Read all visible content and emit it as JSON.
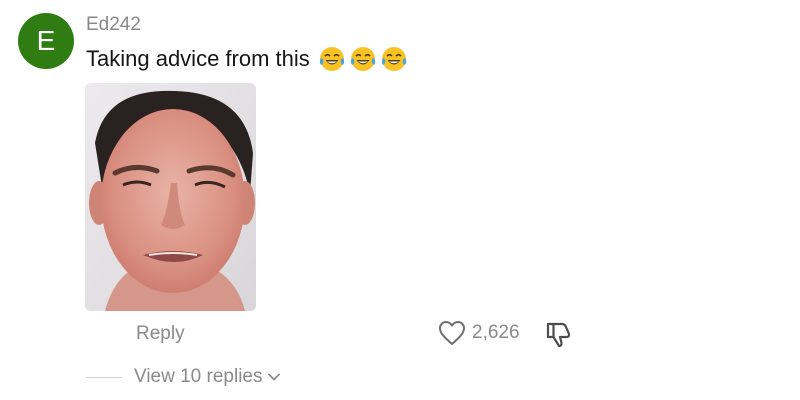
{
  "comment": {
    "avatar_letter": "E",
    "avatar_color": "#2f7d12",
    "username": "Ed242",
    "text": "Taking advice from this",
    "emojis": [
      "face-with-tears-of-joy-icon",
      "face-with-tears-of-joy-icon",
      "face-with-tears-of-joy-icon"
    ],
    "attached_image": "photo of a man's face"
  },
  "actions": {
    "reply_label": "Reply",
    "like_icon": "heart-outline-icon",
    "like_count": "2,626",
    "dislike_icon": "thumbs-down-icon"
  },
  "replies": {
    "view_label": "View 10 replies",
    "toggle_icon": "chevron-down-icon"
  },
  "colors": {
    "text_primary": "#161616",
    "text_secondary": "#8a8a8a",
    "emoji_face": "#f7c324",
    "emoji_tears": "#4aa3e0"
  }
}
